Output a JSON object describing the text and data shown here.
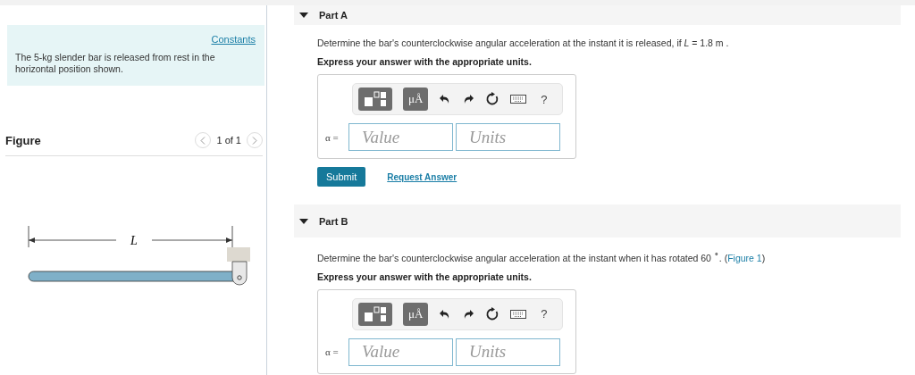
{
  "intro": {
    "constants_link": "Constants",
    "text": "The 5-kg slender bar is released from rest in the horizontal position shown."
  },
  "figure": {
    "title": "Figure",
    "pager": "1 of 1",
    "dimension_label": "L"
  },
  "parts": [
    {
      "title": "Part A",
      "expanded": true,
      "prompt": "Determine the bar's counterclockwise angular acceleration at the instant it is released, if *L* = 1.8 m .",
      "instruction": "Express your answer with the appropriate units.",
      "units_button": "μÅ",
      "help": "?",
      "variable": "α =",
      "value_placeholder": "Value",
      "units_placeholder": "Units",
      "submit": "Submit",
      "request": "Request Answer"
    },
    {
      "title": "Part B",
      "expanded": true,
      "prompt": "Determine the bar's counterclockwise angular acceleration at the instant when it has rotated 60 $^{∘}$. (",
      "prompt_tail": ")",
      "figure_link": "Figure 1",
      "instruction": "Express your answer with the appropriate units.",
      "units_button": "μÅ",
      "help": "?",
      "variable": "α =",
      "value_placeholder": "Value",
      "units_placeholder": "Units"
    }
  ]
}
